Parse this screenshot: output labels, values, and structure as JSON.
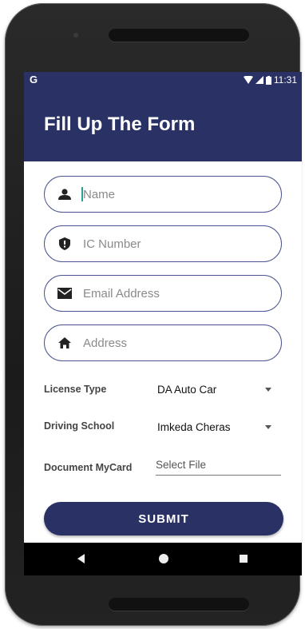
{
  "status": {
    "carrier": "G",
    "time": "11:31"
  },
  "header": {
    "title": "Fill Up The Form"
  },
  "form": {
    "name": {
      "placeholder": "Name",
      "icon": "person-icon"
    },
    "ic_number": {
      "placeholder": "IC Number",
      "icon": "shield-icon"
    },
    "email": {
      "placeholder": "Email Address",
      "icon": "mail-icon"
    },
    "address": {
      "placeholder": "Address",
      "icon": "home-icon"
    },
    "license_type": {
      "label": "License Type",
      "value": "DA Auto Car"
    },
    "driving_school": {
      "label": "Driving School",
      "value": "Imkeda Cheras"
    },
    "document": {
      "label": "Document MyCard",
      "file_placeholder": "Select File"
    },
    "submit_label": "SUBMIT"
  },
  "colors": {
    "primary": "#293165",
    "field_border": "#4a5390"
  }
}
